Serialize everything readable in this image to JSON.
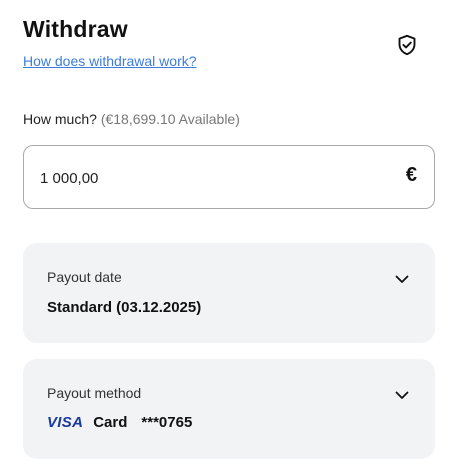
{
  "header": {
    "title": "Withdraw",
    "help_link": "How does withdrawal work?",
    "security_icon": "shield-check-icon"
  },
  "amount": {
    "label": "How much?",
    "available": "(€18,699.10 Available)",
    "value": "1 000,00",
    "currency_symbol": "€"
  },
  "payout_date": {
    "label": "Payout date",
    "value": "Standard (03.12.2025)",
    "expand_icon": "chevron-down-icon"
  },
  "payout_method": {
    "label": "Payout method",
    "card_brand": "VISA",
    "card_type": "Card",
    "card_number": "***0765",
    "expand_icon": "chevron-down-icon"
  },
  "colors": {
    "link": "#3b7ddd",
    "card_background": "#f2f3f5",
    "visa_blue": "#1a3a9c"
  }
}
